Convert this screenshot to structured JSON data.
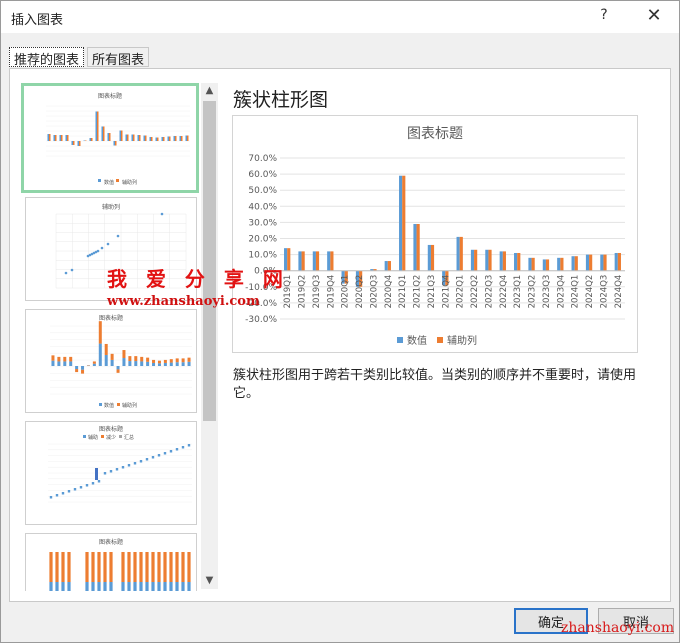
{
  "window": {
    "title": "插入图表",
    "help_symbol": "?",
    "close_symbol": "✕"
  },
  "tabs": [
    {
      "label": "推荐的图表"
    },
    {
      "label": "所有图表"
    }
  ],
  "thumbnails": [
    {
      "title": "图表标题",
      "legend": [
        "数值",
        "辅助列"
      ]
    },
    {
      "title": "辅助列"
    },
    {
      "title": "图表标题",
      "legend": [
        "数值",
        "辅助列"
      ]
    },
    {
      "title": "图表标题",
      "legend": [
        "辅助",
        "减少",
        "汇总"
      ]
    },
    {
      "title": "图表标题"
    }
  ],
  "preview": {
    "heading": "簇状柱形图",
    "description": "簇状柱形图用于跨若干类别比较值。当类别的顺序并不重要时，请使用它。"
  },
  "chart_data": {
    "type": "bar",
    "title": "图表标题",
    "categories": [
      "2019Q1",
      "2019Q2",
      "2019Q3",
      "2019Q4",
      "2020Q1",
      "2020Q2",
      "2020Q3",
      "2020Q4",
      "2021Q1",
      "2021Q2",
      "2021Q3",
      "2021Q4",
      "2022Q1",
      "2022Q2",
      "2022Q3",
      "2022Q4",
      "2023Q1",
      "2023Q2",
      "2023Q3",
      "2023Q4",
      "2024Q1",
      "2024Q2",
      "2024Q3",
      "2024Q4"
    ],
    "series": [
      {
        "name": "数值",
        "color": "#5b9bd5",
        "values": [
          14,
          12,
          12,
          12,
          -8,
          -10,
          1,
          6,
          59,
          29,
          16,
          -9,
          21,
          13,
          13,
          12,
          11,
          8,
          7,
          8,
          9,
          10,
          10,
          11
        ]
      },
      {
        "name": "辅助列",
        "color": "#ed7d31",
        "values": [
          14,
          12,
          12,
          12,
          -8,
          -10,
          1,
          6,
          59,
          29,
          16,
          -9,
          21,
          13,
          13,
          12,
          11,
          8,
          7,
          8,
          9,
          10,
          10,
          11
        ]
      }
    ],
    "ylim": [
      -30,
      70
    ],
    "yticks": [
      "70.0%",
      "60.0%",
      "50.0%",
      "40.0%",
      "30.0%",
      "20.0%",
      "10.0%",
      "0.0%",
      "-10.0%",
      "-20.0%",
      "-30.0%"
    ],
    "legend_position": "bottom",
    "grid": true
  },
  "watermark": {
    "text": "我 爱 分 享 网",
    "url": "www.zhanshaoyi.com",
    "corner": "zhanshaoyi.com"
  },
  "buttons": {
    "ok": "确定",
    "cancel": "取消"
  },
  "colors": {
    "selected_border": "#8fd5a8",
    "primary_border": "#2a73c9",
    "series1": "#5b9bd5",
    "series2": "#ed7d31"
  },
  "icons": {
    "scroll_up": "▲",
    "scroll_down": "▼"
  }
}
